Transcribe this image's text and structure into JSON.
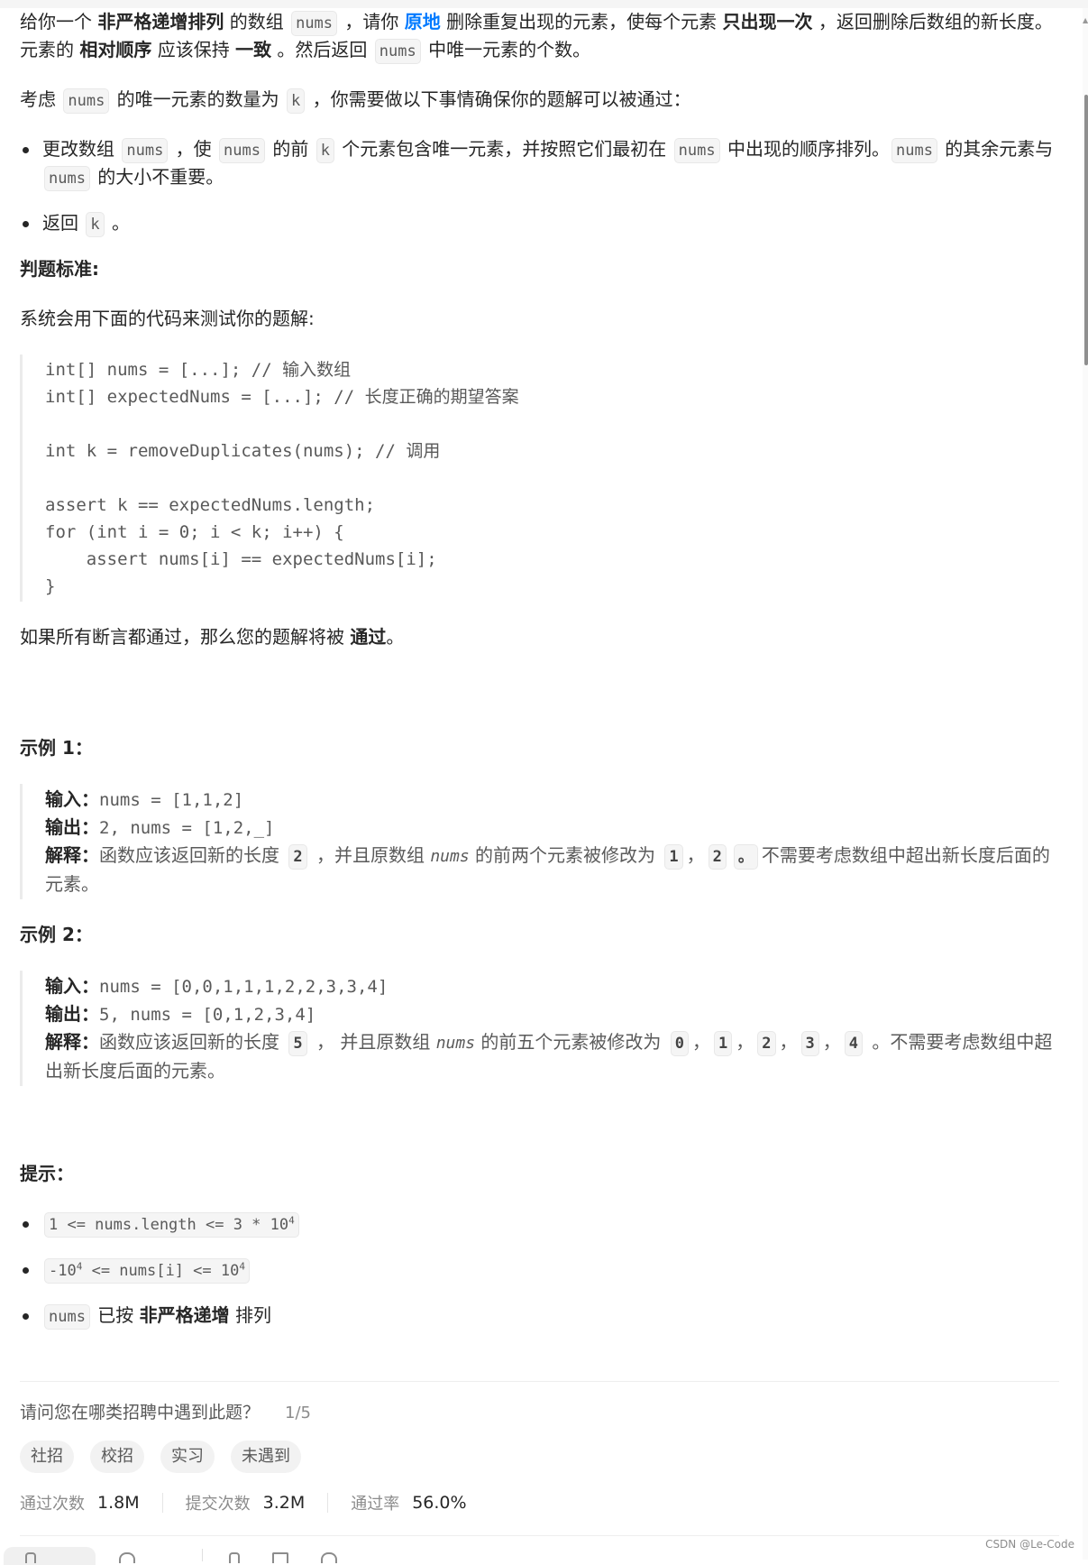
{
  "intro": {
    "p1": [
      {
        "t": "给你一个 "
      },
      {
        "b": "非严格递增排列"
      },
      {
        "t": " 的数组 "
      },
      {
        "c": "nums"
      },
      {
        "t": " ，请你 "
      },
      {
        "l": "原地"
      },
      {
        "t": " 删除重复出现的元素，使每个元素 "
      },
      {
        "b": "只出现一次"
      },
      {
        "t": " ，返回删除后数组的新长度。元素的 "
      },
      {
        "b": "相对顺序"
      },
      {
        "t": " 应该保持 "
      },
      {
        "b": "一致"
      },
      {
        "t": " 。然后返回 "
      },
      {
        "c": "nums"
      },
      {
        "t": " 中唯一元素的个数。"
      }
    ],
    "p2": [
      {
        "t": "考虑 "
      },
      {
        "c": "nums"
      },
      {
        "t": " 的唯一元素的数量为 "
      },
      {
        "c": "k"
      },
      {
        "t": " ，你需要做以下事情确保你的题解可以被通过："
      }
    ]
  },
  "requirements": [
    [
      {
        "t": "更改数组 "
      },
      {
        "c": "nums"
      },
      {
        "t": " ，使 "
      },
      {
        "c": "nums"
      },
      {
        "t": " 的前 "
      },
      {
        "c": "k"
      },
      {
        "t": " 个元素包含唯一元素，并按照它们最初在 "
      },
      {
        "c": "nums"
      },
      {
        "t": " 中出现的顺序排列。"
      },
      {
        "c": "nums"
      },
      {
        "t": " 的其余元素与 "
      },
      {
        "c": "nums"
      },
      {
        "t": " 的大小不重要。"
      }
    ],
    [
      {
        "t": "返回 "
      },
      {
        "c": "k"
      },
      {
        "t": " 。"
      }
    ]
  ],
  "judge": {
    "heading": "判题标准:",
    "intro": "系统会用下面的代码来测试你的题解:",
    "code": "int[] nums = [...]; // 输入数组\nint[] expectedNums = [...]; // 长度正确的期望答案\n\nint k = removeDuplicates(nums); // 调用\n\nassert k == expectedNums.length;\nfor (int i = 0; i < k; i++) {\n    assert nums[i] == expectedNums[i];\n}",
    "conclusion": [
      {
        "t": "如果所有断言都通过，那么您的题解将被 "
      },
      {
        "b": "通过"
      },
      {
        "t": "。"
      }
    ]
  },
  "examples": [
    {
      "title": "示例 1：",
      "input_label": "输入：",
      "input": "nums = [1,1,2]",
      "output_label": "输出：",
      "output": "2, nums = [1,2,_]",
      "explain_label": "解释：",
      "explain": [
        {
          "t": "函数应该返回新的长度 "
        },
        {
          "n": "2"
        },
        {
          "t": " ，并且原数组 "
        },
        {
          "i": "nums"
        },
        {
          "t": " 的前两个元素被修改为 "
        },
        {
          "n": "1"
        },
        {
          "t": "，"
        },
        {
          "n": "2"
        },
        {
          "n": "。"
        },
        {
          "t": "不需要考虑数组中超出新长度后面的元素。"
        }
      ]
    },
    {
      "title": "示例 2：",
      "input_label": "输入：",
      "input": "nums = [0,0,1,1,1,2,2,3,3,4]",
      "output_label": "输出：",
      "output": "5, nums = [0,1,2,3,4]",
      "explain_label": "解释：",
      "explain": [
        {
          "t": "函数应该返回新的长度 "
        },
        {
          "n": "5"
        },
        {
          "t": " ，  并且原数组 "
        },
        {
          "i": "nums"
        },
        {
          "t": " 的前五个元素被修改为 "
        },
        {
          "n": "0"
        },
        {
          "t": "，"
        },
        {
          "n": "1"
        },
        {
          "t": "，"
        },
        {
          "n": "2"
        },
        {
          "t": "，"
        },
        {
          "n": "3"
        },
        {
          "t": "，"
        },
        {
          "n": "4"
        },
        {
          "t": " 。不需要考虑数组中超出新长度后面的元素。"
        }
      ]
    }
  ],
  "hints": {
    "heading": "提示：",
    "items": [
      [
        {
          "c": "1 <= nums.length <= 3 * 10",
          "sup": "4"
        }
      ],
      [
        {
          "c": "-10",
          "sup": "4",
          "c2": " <= nums[i] <= 10",
          "sup2": "4"
        }
      ],
      [
        {
          "c": "nums"
        },
        {
          "t": " 已按 "
        },
        {
          "b": "非严格递增"
        },
        {
          "t": " 排列"
        }
      ]
    ]
  },
  "survey": {
    "question": "请问您在哪类招聘中遇到此题？",
    "progress": "1/5",
    "options": [
      "社招",
      "校招",
      "实习",
      "未遇到"
    ]
  },
  "stats": [
    {
      "label": "通过次数",
      "value": "1.8M"
    },
    {
      "label": "提交次数",
      "value": "3.2M"
    },
    {
      "label": "通过率",
      "value": "56.0%"
    }
  ],
  "watermark": "CSDN @Le-Code"
}
